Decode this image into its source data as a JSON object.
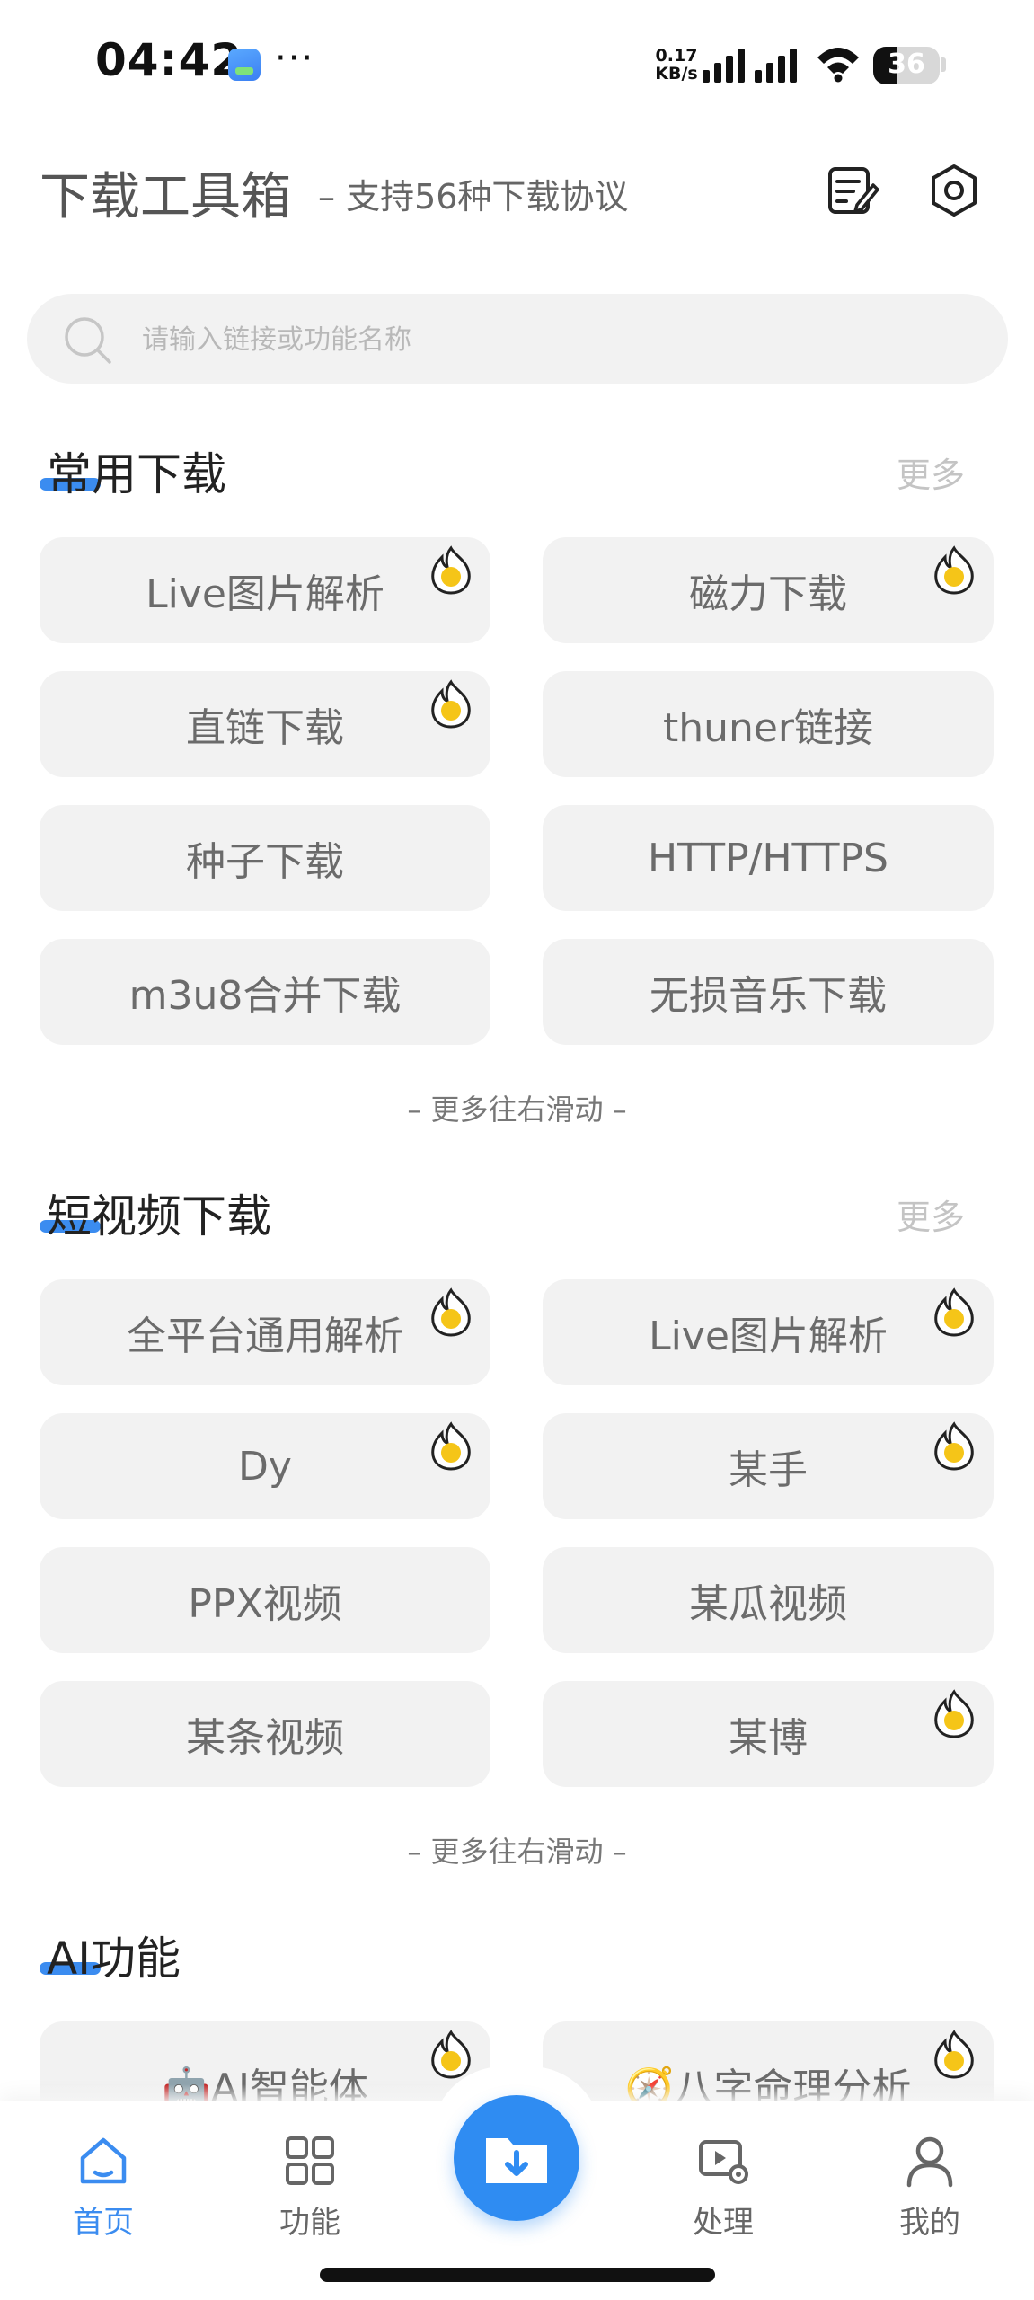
{
  "status_bar": {
    "time": "04:42",
    "more": "···",
    "net_speed_value": "0.17",
    "net_speed_unit": "KB/s",
    "battery": "36",
    "battery_level_percent": 36
  },
  "header": {
    "title": "下载工具箱",
    "subtitle": "– 支持56种下载协议",
    "icons": [
      "edit-note-icon",
      "settings-icon"
    ]
  },
  "search": {
    "placeholder": "请输入链接或功能名称",
    "value": ""
  },
  "sections": [
    {
      "title": "常用下载",
      "more": "更多",
      "items": [
        {
          "label": "Live图片解析",
          "hot": true
        },
        {
          "label": "磁力下载",
          "hot": true
        },
        {
          "label": "直链下载",
          "hot": true
        },
        {
          "label": "thuner链接",
          "hot": false
        },
        {
          "label": "种子下载",
          "hot": false
        },
        {
          "label": "HTTP/HTTPS",
          "hot": false
        },
        {
          "label": "m3u8合并下载",
          "hot": false
        },
        {
          "label": "无损音乐下载",
          "hot": false
        }
      ],
      "hint": "– 更多往右滑动 –"
    },
    {
      "title": "短视频下载",
      "more": "更多",
      "items": [
        {
          "label": "全平台通用解析",
          "hot": true
        },
        {
          "label": "Live图片解析",
          "hot": true
        },
        {
          "label": "Dy",
          "hot": true
        },
        {
          "label": "某手",
          "hot": true
        },
        {
          "label": "PPX视频",
          "hot": false
        },
        {
          "label": "某瓜视频",
          "hot": false
        },
        {
          "label": "某条视频",
          "hot": false
        },
        {
          "label": "某博",
          "hot": true
        }
      ],
      "hint": "– 更多往右滑动 –"
    },
    {
      "title": "AI功能",
      "items": [
        {
          "label": "🤖AI智能体",
          "hot": true
        },
        {
          "label": "🧭八字命理分析",
          "hot": true
        }
      ]
    }
  ],
  "bottom_nav": {
    "items": [
      {
        "label": "首页",
        "icon": "home-icon",
        "active": true
      },
      {
        "label": "功能",
        "icon": "grid-icon",
        "active": false
      },
      {
        "label": "处理",
        "icon": "video-settings-icon",
        "active": false
      },
      {
        "label": "我的",
        "icon": "user-icon",
        "active": false
      }
    ],
    "fab_icon": "folder-download-icon"
  },
  "colors": {
    "accent": "#3b8cf0",
    "tile_bg": "#f2f2f2",
    "tile_text": "#6b6b6b",
    "hot_badge": "#f5c518"
  }
}
